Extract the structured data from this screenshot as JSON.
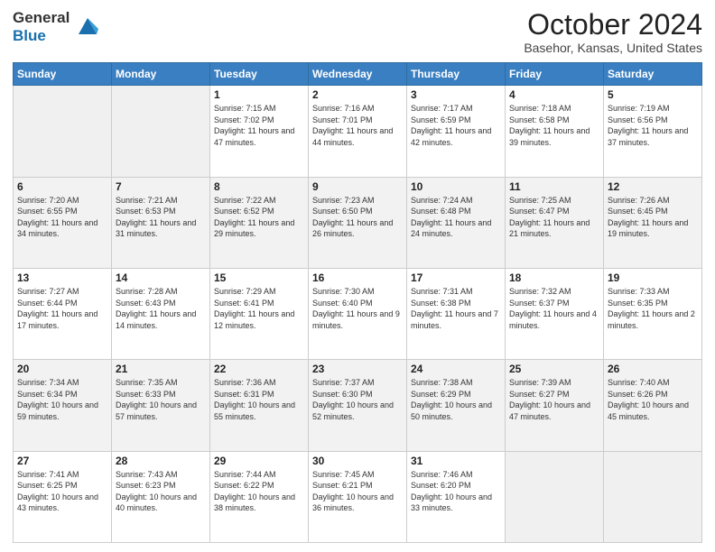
{
  "header": {
    "logo_line1": "General",
    "logo_line2": "Blue",
    "month": "October 2024",
    "location": "Basehor, Kansas, United States"
  },
  "weekdays": [
    "Sunday",
    "Monday",
    "Tuesday",
    "Wednesday",
    "Thursday",
    "Friday",
    "Saturday"
  ],
  "weeks": [
    [
      {
        "day": "",
        "sunrise": "",
        "sunset": "",
        "daylight": ""
      },
      {
        "day": "",
        "sunrise": "",
        "sunset": "",
        "daylight": ""
      },
      {
        "day": "1",
        "sunrise": "Sunrise: 7:15 AM",
        "sunset": "Sunset: 7:02 PM",
        "daylight": "Daylight: 11 hours and 47 minutes."
      },
      {
        "day": "2",
        "sunrise": "Sunrise: 7:16 AM",
        "sunset": "Sunset: 7:01 PM",
        "daylight": "Daylight: 11 hours and 44 minutes."
      },
      {
        "day": "3",
        "sunrise": "Sunrise: 7:17 AM",
        "sunset": "Sunset: 6:59 PM",
        "daylight": "Daylight: 11 hours and 42 minutes."
      },
      {
        "day": "4",
        "sunrise": "Sunrise: 7:18 AM",
        "sunset": "Sunset: 6:58 PM",
        "daylight": "Daylight: 11 hours and 39 minutes."
      },
      {
        "day": "5",
        "sunrise": "Sunrise: 7:19 AM",
        "sunset": "Sunset: 6:56 PM",
        "daylight": "Daylight: 11 hours and 37 minutes."
      }
    ],
    [
      {
        "day": "6",
        "sunrise": "Sunrise: 7:20 AM",
        "sunset": "Sunset: 6:55 PM",
        "daylight": "Daylight: 11 hours and 34 minutes."
      },
      {
        "day": "7",
        "sunrise": "Sunrise: 7:21 AM",
        "sunset": "Sunset: 6:53 PM",
        "daylight": "Daylight: 11 hours and 31 minutes."
      },
      {
        "day": "8",
        "sunrise": "Sunrise: 7:22 AM",
        "sunset": "Sunset: 6:52 PM",
        "daylight": "Daylight: 11 hours and 29 minutes."
      },
      {
        "day": "9",
        "sunrise": "Sunrise: 7:23 AM",
        "sunset": "Sunset: 6:50 PM",
        "daylight": "Daylight: 11 hours and 26 minutes."
      },
      {
        "day": "10",
        "sunrise": "Sunrise: 7:24 AM",
        "sunset": "Sunset: 6:48 PM",
        "daylight": "Daylight: 11 hours and 24 minutes."
      },
      {
        "day": "11",
        "sunrise": "Sunrise: 7:25 AM",
        "sunset": "Sunset: 6:47 PM",
        "daylight": "Daylight: 11 hours and 21 minutes."
      },
      {
        "day": "12",
        "sunrise": "Sunrise: 7:26 AM",
        "sunset": "Sunset: 6:45 PM",
        "daylight": "Daylight: 11 hours and 19 minutes."
      }
    ],
    [
      {
        "day": "13",
        "sunrise": "Sunrise: 7:27 AM",
        "sunset": "Sunset: 6:44 PM",
        "daylight": "Daylight: 11 hours and 17 minutes."
      },
      {
        "day": "14",
        "sunrise": "Sunrise: 7:28 AM",
        "sunset": "Sunset: 6:43 PM",
        "daylight": "Daylight: 11 hours and 14 minutes."
      },
      {
        "day": "15",
        "sunrise": "Sunrise: 7:29 AM",
        "sunset": "Sunset: 6:41 PM",
        "daylight": "Daylight: 11 hours and 12 minutes."
      },
      {
        "day": "16",
        "sunrise": "Sunrise: 7:30 AM",
        "sunset": "Sunset: 6:40 PM",
        "daylight": "Daylight: 11 hours and 9 minutes."
      },
      {
        "day": "17",
        "sunrise": "Sunrise: 7:31 AM",
        "sunset": "Sunset: 6:38 PM",
        "daylight": "Daylight: 11 hours and 7 minutes."
      },
      {
        "day": "18",
        "sunrise": "Sunrise: 7:32 AM",
        "sunset": "Sunset: 6:37 PM",
        "daylight": "Daylight: 11 hours and 4 minutes."
      },
      {
        "day": "19",
        "sunrise": "Sunrise: 7:33 AM",
        "sunset": "Sunset: 6:35 PM",
        "daylight": "Daylight: 11 hours and 2 minutes."
      }
    ],
    [
      {
        "day": "20",
        "sunrise": "Sunrise: 7:34 AM",
        "sunset": "Sunset: 6:34 PM",
        "daylight": "Daylight: 10 hours and 59 minutes."
      },
      {
        "day": "21",
        "sunrise": "Sunrise: 7:35 AM",
        "sunset": "Sunset: 6:33 PM",
        "daylight": "Daylight: 10 hours and 57 minutes."
      },
      {
        "day": "22",
        "sunrise": "Sunrise: 7:36 AM",
        "sunset": "Sunset: 6:31 PM",
        "daylight": "Daylight: 10 hours and 55 minutes."
      },
      {
        "day": "23",
        "sunrise": "Sunrise: 7:37 AM",
        "sunset": "Sunset: 6:30 PM",
        "daylight": "Daylight: 10 hours and 52 minutes."
      },
      {
        "day": "24",
        "sunrise": "Sunrise: 7:38 AM",
        "sunset": "Sunset: 6:29 PM",
        "daylight": "Daylight: 10 hours and 50 minutes."
      },
      {
        "day": "25",
        "sunrise": "Sunrise: 7:39 AM",
        "sunset": "Sunset: 6:27 PM",
        "daylight": "Daylight: 10 hours and 47 minutes."
      },
      {
        "day": "26",
        "sunrise": "Sunrise: 7:40 AM",
        "sunset": "Sunset: 6:26 PM",
        "daylight": "Daylight: 10 hours and 45 minutes."
      }
    ],
    [
      {
        "day": "27",
        "sunrise": "Sunrise: 7:41 AM",
        "sunset": "Sunset: 6:25 PM",
        "daylight": "Daylight: 10 hours and 43 minutes."
      },
      {
        "day": "28",
        "sunrise": "Sunrise: 7:43 AM",
        "sunset": "Sunset: 6:23 PM",
        "daylight": "Daylight: 10 hours and 40 minutes."
      },
      {
        "day": "29",
        "sunrise": "Sunrise: 7:44 AM",
        "sunset": "Sunset: 6:22 PM",
        "daylight": "Daylight: 10 hours and 38 minutes."
      },
      {
        "day": "30",
        "sunrise": "Sunrise: 7:45 AM",
        "sunset": "Sunset: 6:21 PM",
        "daylight": "Daylight: 10 hours and 36 minutes."
      },
      {
        "day": "31",
        "sunrise": "Sunrise: 7:46 AM",
        "sunset": "Sunset: 6:20 PM",
        "daylight": "Daylight: 10 hours and 33 minutes."
      },
      {
        "day": "",
        "sunrise": "",
        "sunset": "",
        "daylight": ""
      },
      {
        "day": "",
        "sunrise": "",
        "sunset": "",
        "daylight": ""
      }
    ]
  ]
}
